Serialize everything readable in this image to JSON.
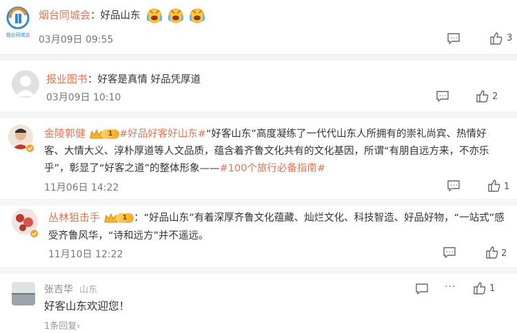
{
  "post": {
    "author": "烟台同城会",
    "avatar_text": "烟台同城会",
    "sep": "：",
    "content": "好品山东",
    "time": "03月09日 09:55",
    "likes": "3"
  },
  "comments": [
    {
      "author": "报业图书",
      "sep": "：",
      "content": "好客是真情 好品凭厚道",
      "time": "03月09日 10:10",
      "likes": "2"
    },
    {
      "author": "金陵郭健",
      "vip_level": "1",
      "tag1": "#好品好客好山东#",
      "line1_rest": "“好客山东”高度凝练了一代代山东人所拥有的崇礼尚宾、热情好",
      "line2": "客、大情大义、淳朴厚道等人文品质，蕴含着齐鲁文化共有的文化基因，所谓“有朋自远方来，不亦乐",
      "line3_pre": "乎”，彰显了“好客之道”的整体形象——",
      "tag2": "#100个旅行必备指南#",
      "time": "11月06日 14:22",
      "likes": "1"
    },
    {
      "author": "丛林狙击手",
      "vip_level": "1",
      "line1": "：“好品山东”有着深厚齐鲁文化蕴藏、灿烂文化、科技智造、好品好物，“一站式”感",
      "line2": "受齐鲁风华，“诗和远方”并不遥远。",
      "time": "11月10日 12:22",
      "likes": "2"
    },
    {
      "author": "张吉华",
      "location": "山东",
      "content": "好客山东欢迎您！",
      "likes": "1",
      "replies": "1条回复",
      "more": "···"
    }
  ],
  "colors": {
    "accent": "#eb7350",
    "text": "#333333",
    "muted": "#777777"
  },
  "icons": [
    "comment-icon",
    "thumb-up-icon",
    "more-icon",
    "vip-crown-icon",
    "verified-badge-icon",
    "laugh-cry-emoji"
  ]
}
